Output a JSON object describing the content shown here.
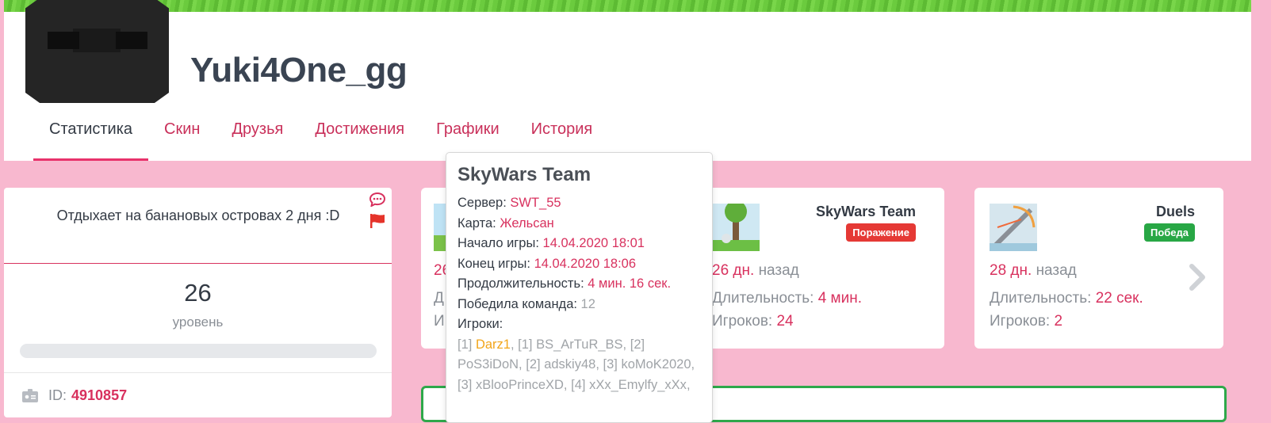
{
  "profile": {
    "nickname": "Yuki4One_gg"
  },
  "tabs": [
    {
      "label": "Статистика",
      "active": true
    },
    {
      "label": "Скин"
    },
    {
      "label": "Друзья"
    },
    {
      "label": "Достижения"
    },
    {
      "label": "Графики"
    },
    {
      "label": "История"
    }
  ],
  "status": {
    "text": "Отдыхает на банановых островах 2 дня :D",
    "level_number": "26",
    "level_label": "уровень",
    "level_progress": 0,
    "id_label": "ID:",
    "id_value": "4910857"
  },
  "popover": {
    "title": "SkyWars Team",
    "server_label": "Сервер:",
    "server_value": "SWT_55",
    "map_label": "Карта:",
    "map_value": "Жельсан",
    "start_label": "Начало игры:",
    "start_value": "14.04.2020 18:01",
    "end_label": "Конец игры:",
    "end_value": "14.04.2020 18:06",
    "duration_label": "Продолжительность:",
    "duration_value": "4 мин. 16 сек.",
    "winner_label": "Победила команда:",
    "winner_value": "12",
    "players_label": "Игроки:",
    "players": {
      "t1": "[1]",
      "p1": "Darz1",
      "sep": ",",
      "t2": "[1]",
      "p2": "BS_ArTuR_BS",
      "t3": "[2]",
      "p3": "PoS3iDoN",
      "t4": "[2]",
      "p4": "adskiy48",
      "t5": "[3]",
      "p5": "koMoK2020",
      "t6": "[3]",
      "p6": "xBlooPrinceXD",
      "t7": "[4]",
      "p7": "xXx_Emylfy_xXx"
    }
  },
  "games": [
    {
      "ago_num": "26",
      "line1_label": "Д",
      "line2_label": "И"
    },
    {
      "title": "SkyWars Team",
      "result": "Поражение",
      "result_color": "#e53935",
      "ago_num": "26 дн.",
      "ago_word": "назад",
      "duration_label": "Длительность:",
      "duration_value": "4 мин.",
      "players_label": "Игроков:",
      "players_value": "24"
    },
    {
      "title": "Duels",
      "result": "Победа",
      "result_color": "#28a745",
      "ago_num": "28 дн.",
      "ago_word": "назад",
      "duration_label": "Длительность:",
      "duration_value": "22 сек.",
      "players_label": "Игроков:",
      "players_value": "2"
    }
  ],
  "icons": {
    "chat": "chat-bubble-icon",
    "flag": "flag-icon",
    "next": "chevron-right-icon",
    "id": "id-card-icon"
  },
  "colors": {
    "accent": "#d8315e",
    "background": "#f8b8cf",
    "win": "#28a745",
    "loss": "#e53935"
  }
}
